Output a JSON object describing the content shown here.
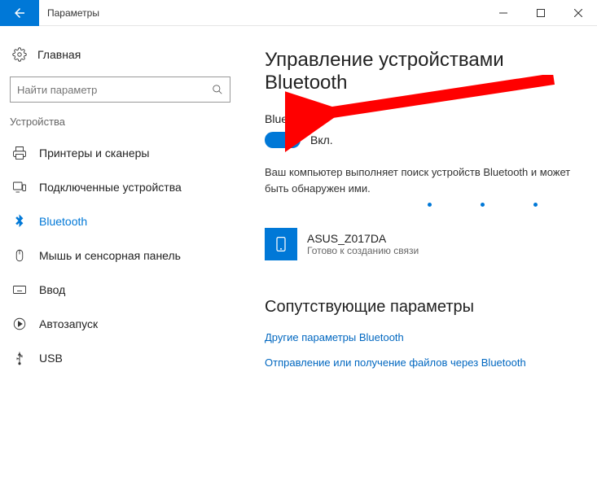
{
  "titlebar": {
    "title": "Параметры"
  },
  "sidebar": {
    "home": "Главная",
    "search_placeholder": "Найти параметр",
    "section": "Устройства",
    "items": [
      {
        "label": "Принтеры и сканеры"
      },
      {
        "label": "Подключенные устройства"
      },
      {
        "label": "Bluetooth"
      },
      {
        "label": "Мышь и сенсорная панель"
      },
      {
        "label": "Ввод"
      },
      {
        "label": "Автозапуск"
      },
      {
        "label": "USB"
      }
    ]
  },
  "content": {
    "heading": "Управление устройствами Bluetooth",
    "bt_label": "Bluetooth",
    "toggle_state": "Вкл.",
    "status_text": "Ваш компьютер выполняет поиск устройств Bluetooth и может быть обнаружен ими.",
    "device": {
      "name": "ASUS_Z017DA",
      "status": "Готово к созданию связи"
    },
    "related_heading": "Сопутствующие параметры",
    "link1": "Другие параметры Bluetooth",
    "link2": "Отправление или получение файлов через Bluetooth"
  }
}
